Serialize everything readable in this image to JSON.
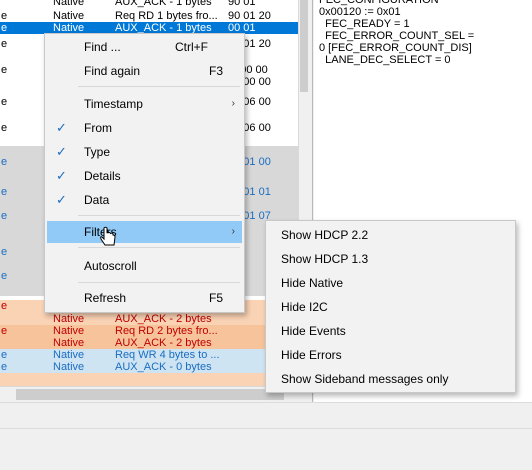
{
  "colors": {
    "row_selected": "#0078d7",
    "row_gray": "#d8d8d8",
    "row_orange": "#fad2b4",
    "row_orange_dark": "#f7c39a",
    "row_blue_light": "#cfe4f2",
    "text_red": "#c00000",
    "text_blue": "#1a6dc2",
    "menu_highlight": "#91c9f7"
  },
  "message_list": {
    "rows": [
      {
        "from": "Native",
        "details": "AUX_ACK - 1 bytes",
        "data": "90 01"
      },
      {
        "from": "Native",
        "details": "Req RD 1 bytes fro...",
        "data": "90 01 20"
      },
      {
        "from": "Native",
        "details": "AUX_ACK - 1 bytes",
        "data": "00 01"
      },
      {
        "from": "",
        "details": "",
        "data": "30 01 20"
      },
      {
        "from": "",
        "details": "",
        "data": ""
      },
      {
        "from": "",
        "details": "",
        "data": "3f 00 00"
      },
      {
        "from": "",
        "details": "",
        "data": "00 00 00"
      },
      {
        "from": "",
        "details": "",
        "data": "30 06 00"
      },
      {
        "from": "",
        "details": "",
        "data": "00"
      },
      {
        "from": "",
        "details": "",
        "data": "30 06 00"
      },
      {
        "from": "",
        "details": "",
        "data": "00"
      },
      {
        "from": "",
        "details": "",
        "data": "30"
      },
      {
        "from": "",
        "details": "",
        "data": "30 01 00"
      },
      {
        "from": "",
        "details": "",
        "data": "00"
      },
      {
        "from": "",
        "details": "",
        "data": "30"
      },
      {
        "from": "",
        "details": "",
        "data": "30 01 01"
      },
      {
        "from": "",
        "details": "",
        "data": "00"
      },
      {
        "from": "",
        "details": "",
        "data": "30 01 07"
      },
      {
        "from": "Native",
        "details": "AUX_ACK - 2 bytes",
        "data": ""
      },
      {
        "from": "Native",
        "details": "Req RD 2 bytes fro...",
        "data": ""
      },
      {
        "from": "Native",
        "details": "AUX_ACK - 2 bytes",
        "data": ""
      },
      {
        "from": "Native",
        "details": "Req WR 4 bytes to ...",
        "data": ""
      },
      {
        "from": "Native",
        "details": "AUX_ACK - 0 bytes",
        "data": ""
      }
    ]
  },
  "detail_pane": {
    "text": "FEC_CONFIGURATION\n0x00120 := 0x01\n  FEC_READY = 1\n  FEC_ERROR_COUNT_SEL =\n0 [FEC_ERROR_COUNT_DIS]\n  LANE_DEC_SELECT = 0"
  },
  "context_menu": {
    "find": {
      "label": "Find ...",
      "shortcut": "Ctrl+F"
    },
    "find_again": {
      "label": "Find again",
      "shortcut": "F3"
    },
    "timestamp": {
      "label": "Timestamp"
    },
    "from": {
      "label": "From",
      "checked": true
    },
    "type": {
      "label": "Type",
      "checked": true
    },
    "details": {
      "label": "Details",
      "checked": true
    },
    "data": {
      "label": "Data",
      "checked": true
    },
    "filters": {
      "label": "Filters"
    },
    "autoscroll": {
      "label": "Autoscroll"
    },
    "refresh": {
      "label": "Refresh",
      "shortcut": "F5"
    },
    "check_glyph": "✓",
    "arrow_glyph": "›"
  },
  "filters_submenu": {
    "items": [
      "Show HDCP 2.2",
      "Show HDCP 1.3",
      "Hide Native",
      "Hide I2C",
      "Hide Events",
      "Hide Errors",
      "Show Sideband messages only"
    ]
  }
}
